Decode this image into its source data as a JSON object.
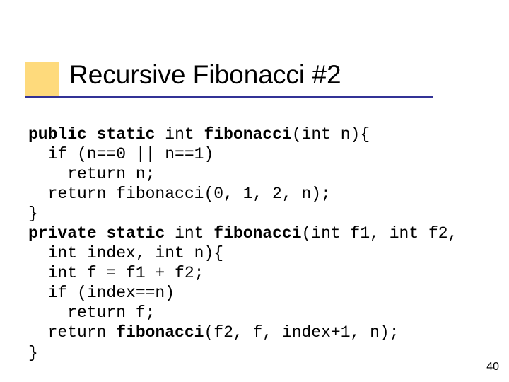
{
  "title": "Recursive Fibonacci #2",
  "page_number": "40",
  "code": {
    "line1a": "public",
    "line1b": " ",
    "line1c": "static",
    "line1d": " int ",
    "line1e": "fibonacci",
    "line1f": "(int n){",
    "line2": "  if (n==0 || n==1)",
    "line3": "    return n;",
    "line4": "  return fibonacci(0, 1, 2, n);",
    "line5": "}",
    "line6a": "private",
    "line6b": " ",
    "line6c": "static",
    "line6d": " int ",
    "line6e": "fibonacci",
    "line6f": "(int f1, int f2,",
    "line7": "  int index, int n){",
    "line8": "  int f = f1 + f2;",
    "line9": "  if (index==n)",
    "line10": "    return f;",
    "line11": "  return ",
    "line11b": "fibonacci",
    "line11c": "(f2, f, index+1, n);",
    "line12": "}"
  }
}
